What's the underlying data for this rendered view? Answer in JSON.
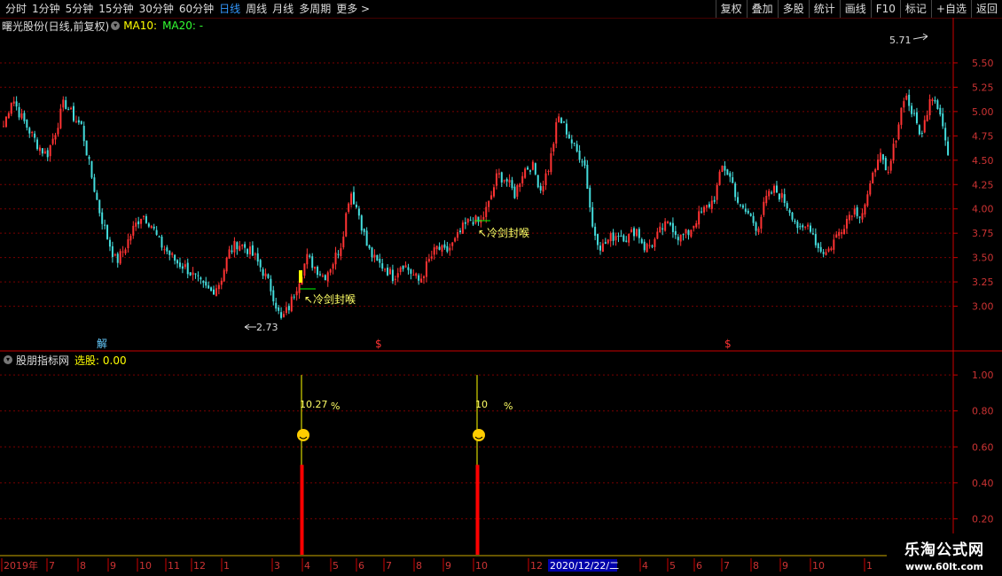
{
  "toolbar": {
    "periods": [
      "分时",
      "1分钟",
      "5分钟",
      "15分钟",
      "30分钟",
      "60分钟",
      "日线",
      "周线",
      "月线",
      "多周期",
      "更多 >"
    ],
    "active_period": "日线",
    "right_buttons": [
      "复权",
      "叠加",
      "多股",
      "统计",
      "画线",
      "F10",
      "标记",
      "+自选",
      "返回"
    ]
  },
  "main_panel": {
    "stock_title": "曙光股份(日线,前复权)",
    "ma10_label": "MA10:",
    "ma20_label": "MA20: -",
    "colors": {
      "up": "#ff3333",
      "down": "#44dddd",
      "ma10": "#ffff00",
      "ma20": "#00ff00",
      "axis": "#cc0000"
    }
  },
  "sub_panel": {
    "indicator_name": "股朋指标网",
    "pick_label": "选股: 0.00"
  },
  "chart_data": [
    {
      "type": "candlestick",
      "title": "曙光股份(日线,前复权)",
      "y_ticks": [
        5.5,
        5.25,
        5.0,
        4.75,
        4.5,
        4.25,
        4.0,
        3.75,
        3.5,
        3.25,
        3.0
      ],
      "ylim": [
        2.55,
        5.8
      ],
      "grid": true,
      "close_trace": [
        4.85,
        5.15,
        4.95,
        4.8,
        4.65,
        4.55,
        4.8,
        5.1,
        4.95,
        4.85,
        4.4,
        4.0,
        3.7,
        3.45,
        3.6,
        3.8,
        3.95,
        3.85,
        3.65,
        3.55,
        3.45,
        3.4,
        3.3,
        3.2,
        3.15,
        3.25,
        3.55,
        3.65,
        3.6,
        3.5,
        3.35,
        3.15,
        2.85,
        3.0,
        3.25,
        3.5,
        3.4,
        3.3,
        3.45,
        3.65,
        4.2,
        3.95,
        3.6,
        3.45,
        3.4,
        3.3,
        3.45,
        3.35,
        3.25,
        3.45,
        3.6,
        3.55,
        3.65,
        3.8,
        3.9,
        3.85,
        4.05,
        4.35,
        4.3,
        4.15,
        4.4,
        4.45,
        4.2,
        4.45,
        4.95,
        4.8,
        4.6,
        4.5,
        3.8,
        3.6,
        3.7,
        3.75,
        3.7,
        3.8,
        3.6,
        3.65,
        3.8,
        3.85,
        3.7,
        3.75,
        3.9,
        4.0,
        4.1,
        4.45,
        4.3,
        4.0,
        3.95,
        3.8,
        4.1,
        4.2,
        4.1,
        3.95,
        3.75,
        3.85,
        3.6,
        3.55,
        3.7,
        3.85,
        4.0,
        3.95,
        4.2,
        4.6,
        4.3,
        4.75,
        5.2,
        4.95,
        4.75,
        5.2,
        5.05,
        4.55
      ],
      "annotations": {
        "low_label": "2.73",
        "high_label": "5.71",
        "signal_label": "↖冷剑封喉",
        "marker_jie": "解",
        "marker_s": "$"
      }
    },
    {
      "type": "bar",
      "title": "股朋指标网",
      "y_ticks": [
        1.0,
        0.8,
        0.6,
        0.4,
        0.2
      ],
      "ylim": [
        0,
        1.05
      ],
      "signals": [
        {
          "label": "10.27",
          "percent_sign": "%",
          "value": 1.0
        },
        {
          "label": "10",
          "percent_sign": "%",
          "value": 1.0
        }
      ]
    }
  ],
  "x_axis": {
    "labels": [
      "2019年",
      "7",
      "8",
      "9",
      "10",
      "11",
      "12",
      "1",
      "3",
      "4",
      "5",
      "6",
      "7",
      "8",
      "9",
      "10",
      "12",
      "4",
      "5",
      "6",
      "7",
      "8",
      "9",
      "10",
      "1"
    ],
    "highlight_date": "2020/12/22/二"
  },
  "watermark": {
    "title": "乐淘公式网",
    "url": "www.60lt.com"
  }
}
